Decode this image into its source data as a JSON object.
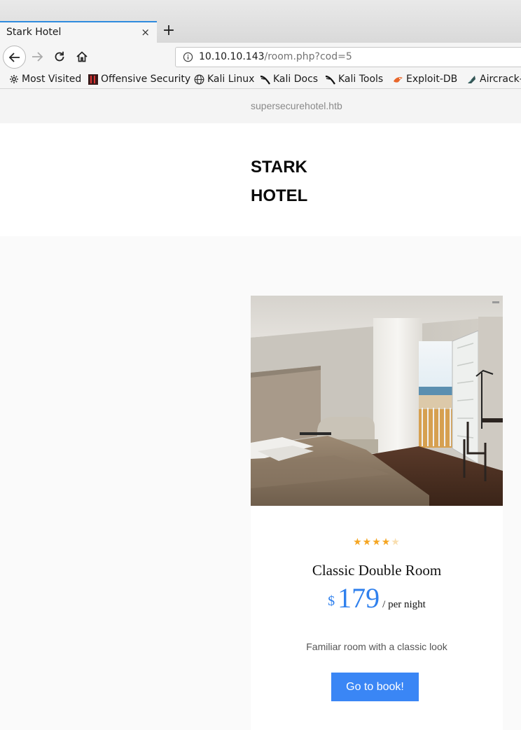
{
  "browser": {
    "tab_title": "Stark Hotel",
    "tab_close": "×",
    "new_tab": "+",
    "url_host": "10.10.10.143",
    "url_path": "/room.php?cod=5",
    "bookmarks": [
      {
        "label": "Most Visited",
        "icon": "gear-icon"
      },
      {
        "label": "Offensive Security",
        "icon": "offsec-icon"
      },
      {
        "label": "Kali Linux",
        "icon": "globe-icon"
      },
      {
        "label": "Kali Docs",
        "icon": "kali-icon"
      },
      {
        "label": "Kali Tools",
        "icon": "kali-icon"
      },
      {
        "label": "Exploit-DB",
        "icon": "exploitdb-icon"
      },
      {
        "label": "Aircrack-",
        "icon": "aircrack-icon"
      }
    ]
  },
  "site": {
    "domain": "supersecurehotel.htb",
    "brand_line1": "STARK",
    "brand_line2": "HOTEL"
  },
  "room": {
    "stars_filled": 4,
    "stars_total": 5,
    "name": "Classic Double Room",
    "currency": "$",
    "price": "179",
    "per": "/ per night",
    "description": "Familiar room with a classic look",
    "book_label": "Go to book!"
  },
  "colors": {
    "accent": "#3a86f5",
    "price": "#2f80ed",
    "star": "#f5a623",
    "tab_highlight": "#2f8bde"
  }
}
